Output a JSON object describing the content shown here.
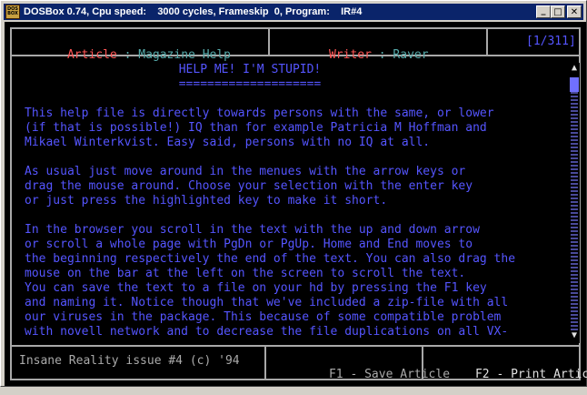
{
  "window": {
    "title": "DOSBox 0.74, Cpu speed:    3000 cycles, Frameskip  0, Program:    IR#4",
    "icon_label_top": "DOS",
    "icon_label_bottom": "BOX",
    "minimize_icon": "minimize-icon",
    "maximize_icon": "maximize-icon",
    "close_icon": "close-icon",
    "minimize_glyph": "_",
    "maximize_glyph": "□",
    "close_glyph": "✕"
  },
  "header": {
    "article_label": "Article",
    "article_sep": " : ",
    "article_value": "Magazine Help",
    "writer_label": "Writer",
    "writer_sep": " : ",
    "writer_value": "Raver",
    "page_counter": "[1/311]"
  },
  "content": {
    "heading": "HELP ME! I'M STUPID!",
    "heading_underline": "====================",
    "lines": [
      "This help file is directly towards persons with the same, or lower",
      "(if that is possible!) IQ than for example Patricia M Hoffman and",
      "Mikael Winterkvist. Easy said, persons with no IQ at all.",
      "",
      "As usual just move around in the menues with the arrow keys or",
      "drag the mouse around. Choose your selection with the enter key",
      "or just press the highlighted key to make it short.",
      "",
      "In the browser you scroll in the text with the up and down arrow",
      "or scroll a whole page with PgDn or PgUp. Home and End moves to",
      "the beginning respectively the end of the text. You can also drag the",
      "mouse on the bar at the left on the screen to scroll the text.",
      "You can save the text to a file on your hd by pressing the F1 key",
      "and naming it. Notice though that we've included a zip-file with all",
      "our viruses in the package. This because of some compatible problem",
      "with novell network and to decrease the file duplications on all VX-"
    ]
  },
  "scrollbar": {
    "up_glyph": "▲",
    "down_glyph": "▼"
  },
  "footer": {
    "issue_text": "Insane Reality issue #4 (c) '94",
    "save_key": "F1",
    "save_sep": " - ",
    "save_label": "Save Article",
    "print_key": "F2",
    "print_sep": " - ",
    "print_label": "Print Article"
  }
}
